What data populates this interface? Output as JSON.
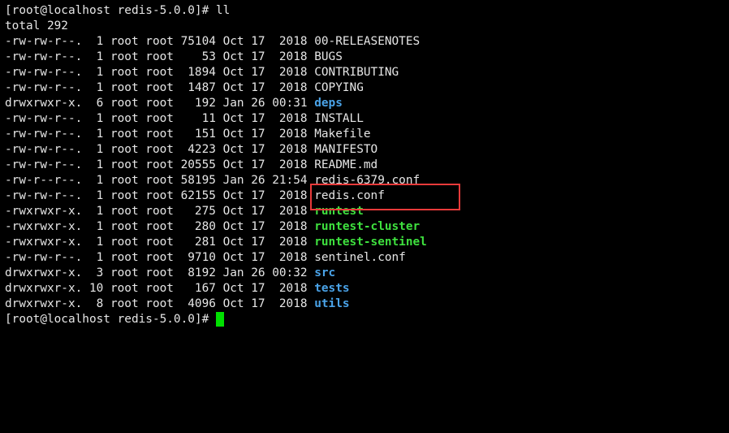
{
  "terminal": {
    "command_prompt": "[root@localhost redis-5.0.0]# ll",
    "total_line": "total 292",
    "entries": [
      {
        "meta": "-rw-rw-r--.  1 root root 75104 Oct 17  2018 ",
        "name": "00-RELEASENOTES",
        "kind": "file"
      },
      {
        "meta": "-rw-rw-r--.  1 root root    53 Oct 17  2018 ",
        "name": "BUGS",
        "kind": "file"
      },
      {
        "meta": "-rw-rw-r--.  1 root root  1894 Oct 17  2018 ",
        "name": "CONTRIBUTING",
        "kind": "file"
      },
      {
        "meta": "-rw-rw-r--.  1 root root  1487 Oct 17  2018 ",
        "name": "COPYING",
        "kind": "file"
      },
      {
        "meta": "drwxrwxr-x.  6 root root   192 Jan 26 00:31 ",
        "name": "deps",
        "kind": "dir"
      },
      {
        "meta": "-rw-rw-r--.  1 root root    11 Oct 17  2018 ",
        "name": "INSTALL",
        "kind": "file"
      },
      {
        "meta": "-rw-rw-r--.  1 root root   151 Oct 17  2018 ",
        "name": "Makefile",
        "kind": "file"
      },
      {
        "meta": "-rw-rw-r--.  1 root root  4223 Oct 17  2018 ",
        "name": "MANIFESTO",
        "kind": "file"
      },
      {
        "meta": "-rw-rw-r--.  1 root root 20555 Oct 17  2018 ",
        "name": "README.md",
        "kind": "file"
      },
      {
        "meta": "-rw-r--r--.  1 root root 58195 Jan 26 21:54 ",
        "name": "redis-6379.conf",
        "kind": "file"
      },
      {
        "meta": "-rw-rw-r--.  1 root root 62155 Oct 17  2018 ",
        "name": "redis.conf",
        "kind": "file"
      },
      {
        "meta": "-rwxrwxr-x.  1 root root   275 Oct 17  2018 ",
        "name": "runtest",
        "kind": "exec"
      },
      {
        "meta": "-rwxrwxr-x.  1 root root   280 Oct 17  2018 ",
        "name": "runtest-cluster",
        "kind": "exec"
      },
      {
        "meta": "-rwxrwxr-x.  1 root root   281 Oct 17  2018 ",
        "name": "runtest-sentinel",
        "kind": "exec"
      },
      {
        "meta": "-rw-rw-r--.  1 root root  9710 Oct 17  2018 ",
        "name": "sentinel.conf",
        "kind": "file"
      },
      {
        "meta": "drwxrwxr-x.  3 root root  8192 Jan 26 00:32 ",
        "name": "src",
        "kind": "dir"
      },
      {
        "meta": "drwxrwxr-x. 10 root root   167 Oct 17  2018 ",
        "name": "tests",
        "kind": "dir"
      },
      {
        "meta": "drwxrwxr-x.  8 root root  4096 Oct 17  2018 ",
        "name": "utils",
        "kind": "dir"
      }
    ],
    "final_prompt": "[root@localhost redis-5.0.0]# "
  },
  "colors": {
    "background": "#000000",
    "text": "#e6e6e6",
    "directory": "#4aa3e8",
    "executable": "#3ee03e",
    "cursor": "#00e000",
    "highlight_box": "#e83a3a"
  }
}
